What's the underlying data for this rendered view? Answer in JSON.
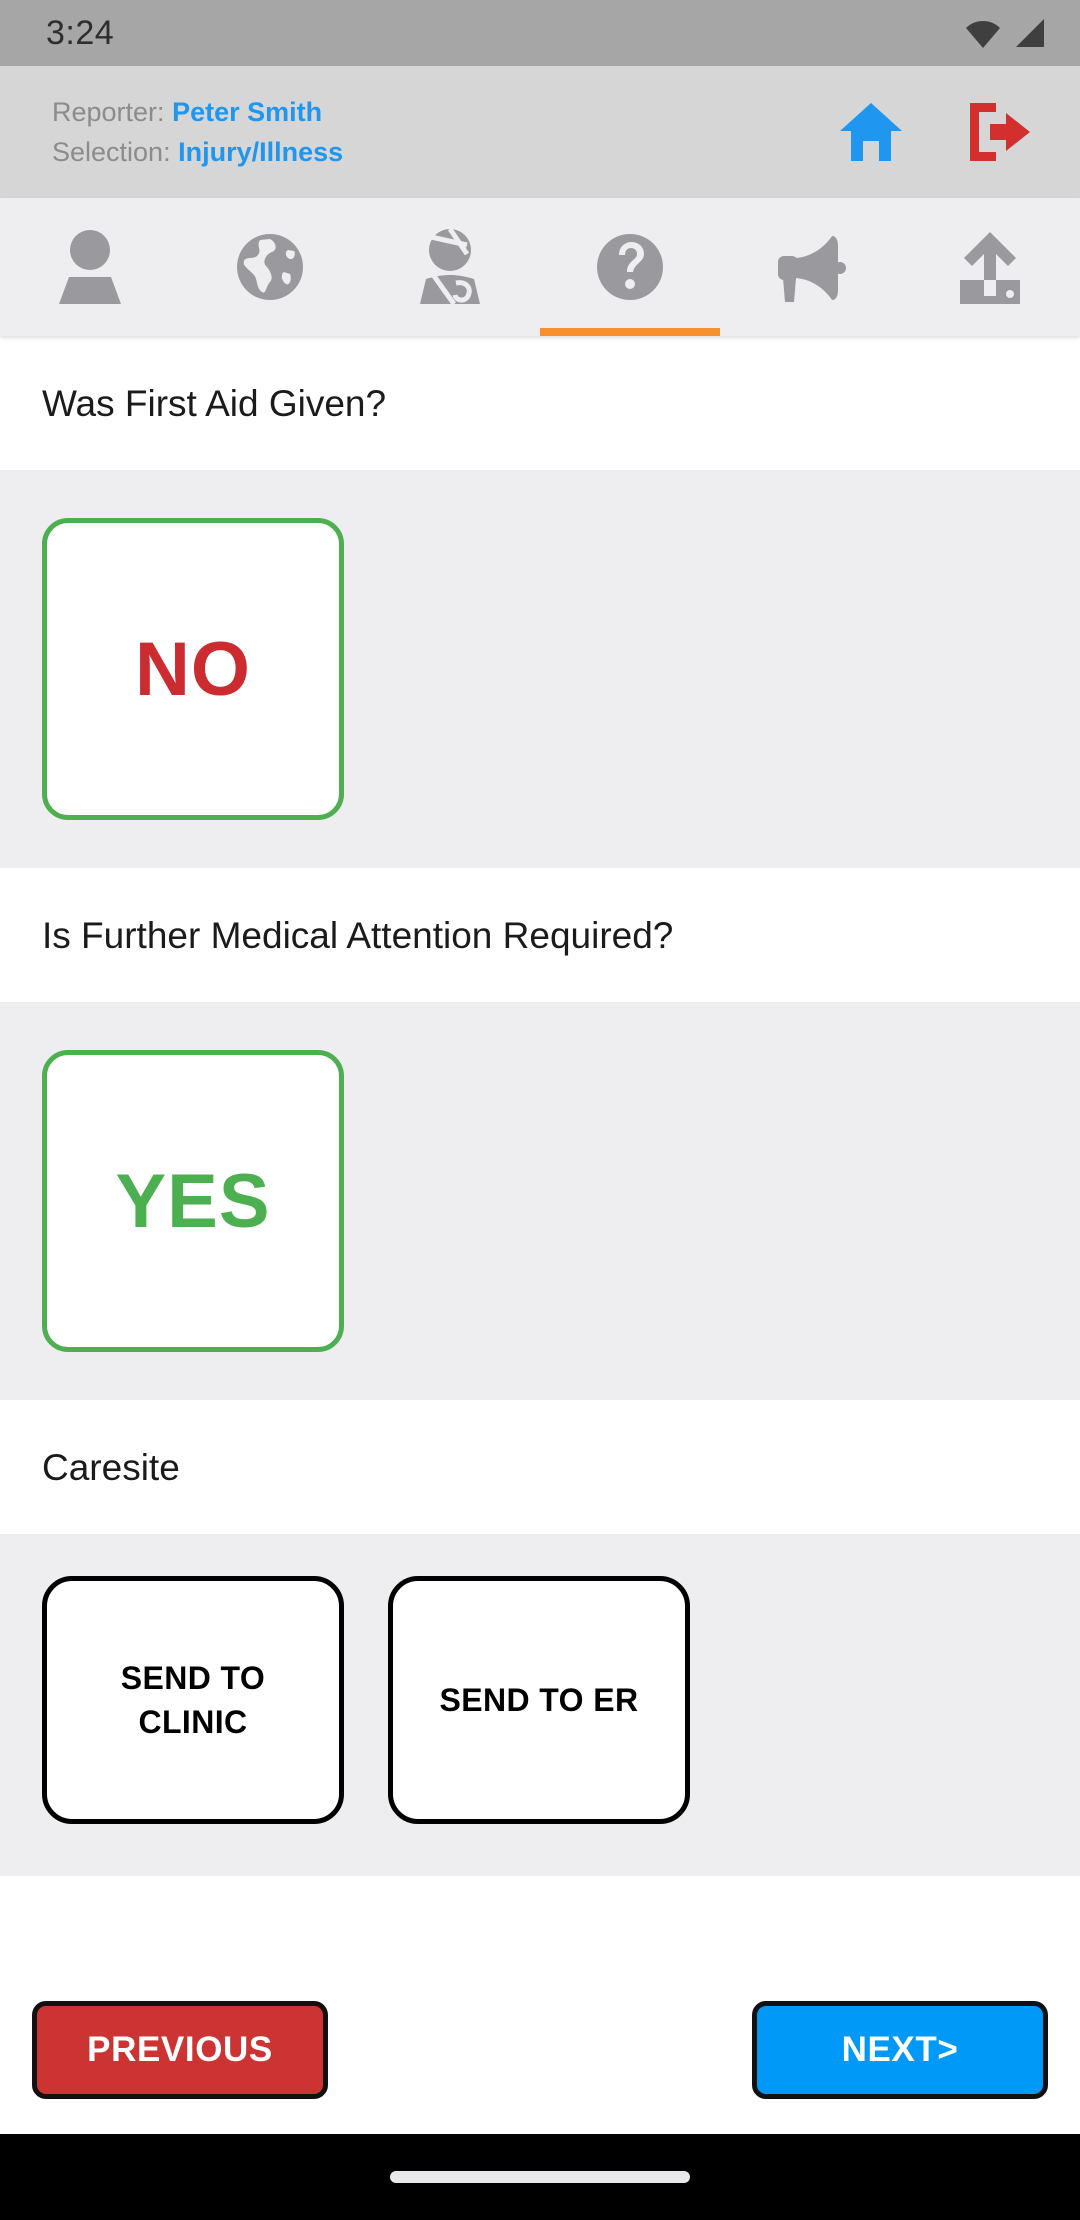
{
  "status_bar": {
    "time": "3:24",
    "icons": [
      "wifi-icon",
      "signal-icon"
    ]
  },
  "header": {
    "reporter_label": "Reporter:",
    "reporter_value": "Peter Smith",
    "selection_label": "Selection:",
    "selection_value": "Injury/Illness",
    "home_icon": "home-icon",
    "logout_icon": "logout-icon",
    "home_color": "#1f96f0",
    "logout_color": "#d32f2f"
  },
  "tabs": {
    "active_index": 3,
    "indicator_color": "#f5912e",
    "items": [
      {
        "icon": "person-icon",
        "name": "tab-person"
      },
      {
        "icon": "globe-icon",
        "name": "tab-globe"
      },
      {
        "icon": "injured-person-icon",
        "name": "tab-injury"
      },
      {
        "icon": "question-mark-circle-icon",
        "name": "tab-questions"
      },
      {
        "icon": "megaphone-icon",
        "name": "tab-announcements"
      },
      {
        "icon": "upload-icon",
        "name": "tab-upload"
      }
    ]
  },
  "sections": [
    {
      "question": "Was First Aid Given?",
      "choice": {
        "label": "NO",
        "color": "#cc2b30",
        "border": "#4caf50",
        "selected": true
      }
    },
    {
      "question": "Is Further Medical Attention Required?",
      "choice": {
        "label": "YES",
        "color": "#4caf50",
        "border": "#4caf50",
        "selected": true
      }
    }
  ],
  "caresite": {
    "title": "Caresite",
    "options": [
      {
        "label": "SEND TO CLINIC"
      },
      {
        "label": "SEND TO ER"
      }
    ]
  },
  "footer": {
    "previous_label": "PREVIOUS",
    "next_label": "NEXT>",
    "previous_color": "#cc3333",
    "next_color": "#0099f7"
  }
}
